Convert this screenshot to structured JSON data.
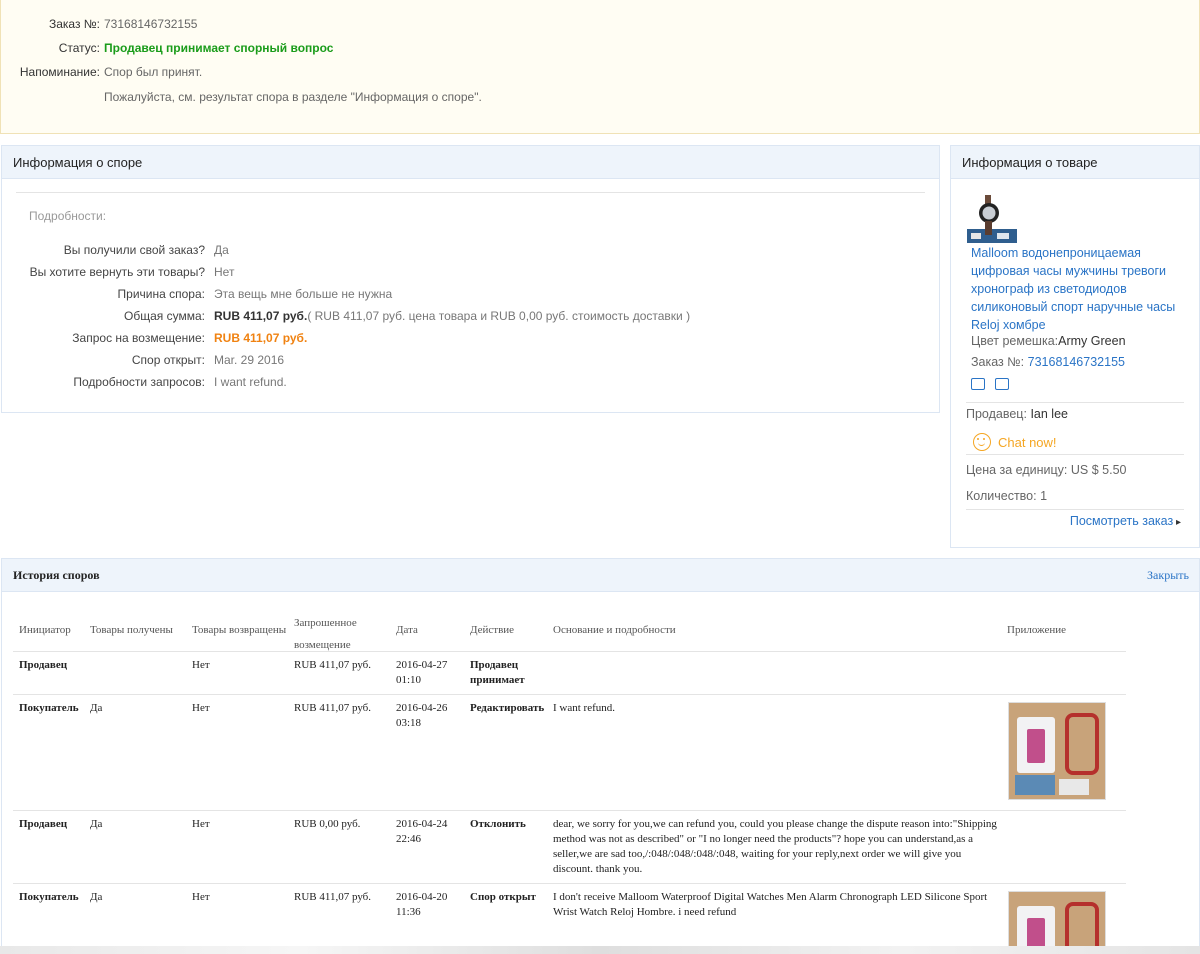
{
  "order": {
    "number_label": "Заказ №:",
    "number": "73168146732155",
    "status_label": "Статус:",
    "status": "Продавец принимает спорный вопрос",
    "reminder_label": "Напоминание:",
    "reminder_line1": "Спор был принят.",
    "reminder_line2": "Пожалуйста, см. результат спора в разделе \"Информация о споре\"."
  },
  "dispute": {
    "title": "Информация о споре",
    "details_title": "Подробности:",
    "rows": [
      {
        "label": "Вы получили свой заказ?",
        "value": "Да"
      },
      {
        "label": "Вы хотите вернуть эти товары?",
        "value": "Нет"
      },
      {
        "label": "Причина спора:",
        "value": "Эта вещь мне больше не нужна"
      },
      {
        "label": "Общая сумма:",
        "value_bold": "RUB 411,07 руб.",
        "value": "( RUB 411,07 руб. цена товара и RUB 0,00 руб. стоимость доставки )"
      },
      {
        "label": "Запрос на возмещение:",
        "value": "RUB 411,07 руб."
      },
      {
        "label": "Спор открыт:",
        "value": "Mar. 29 2016"
      },
      {
        "label": "Подробности запросов:",
        "value": "I want refund."
      }
    ]
  },
  "product": {
    "title": "Информация о товаре",
    "name": "Malloom водонепроницаемая цифровая часы мужчины тревоги хронограф из светодиодов силиконовый спорт наручные часы Reloj хомбре",
    "strap_label": "Цвет ремешка:",
    "strap_value": "Army Green",
    "order_label": "Заказ №:",
    "order_number": "73168146732155",
    "seller_label": "Продавец:",
    "seller_name": "Ian lee",
    "chat_label": "Chat now!",
    "price_label": "Цена за единицу:",
    "price_value": "US $ 5.50",
    "qty_label": "Количество:",
    "qty_value": "1",
    "view_order": "Посмотреть заказ"
  },
  "history": {
    "title": "История споров",
    "close_label": "Закрыть",
    "columns": [
      "Инициатор",
      "Товары получены",
      "Товары возвращены",
      "Запрошенное возмещение",
      "Дата",
      "Действие",
      "Основание и подробности",
      "Приложение"
    ],
    "rows": [
      {
        "initiator": "Продавец",
        "received": "",
        "returned": "Нет",
        "refund": "RUB 411,07 руб.",
        "date": "2016-04-27",
        "time": "01:10",
        "action": "Продавец принимает",
        "reason": "",
        "attachment": false
      },
      {
        "initiator": "Покупатель",
        "received": "Да",
        "returned": "Нет",
        "refund": "RUB 411,07 руб.",
        "date": "2016-04-26",
        "time": "03:18",
        "action": "Редактировать",
        "reason": "I want refund.",
        "attachment": true
      },
      {
        "initiator": "Продавец",
        "received": "Да",
        "returned": "Нет",
        "refund": "RUB 0,00 руб.",
        "date": "2016-04-24",
        "time": "22:46",
        "action": "Отклонить",
        "reason": "dear, we sorry for you,we can refund you, could you please change the dispute reason into:\"Shipping method was not as described\" or \"I no longer need the products\"? hope you can understand,as a seller,we are sad too,/:048/:048/:048/:048, waiting for your reply,next order we will give you discount. thank you.",
        "attachment": false
      },
      {
        "initiator": "Покупатель",
        "received": "Да",
        "returned": "Нет",
        "refund": "RUB 411,07 руб.",
        "date": "2016-04-20",
        "time": "11:36",
        "action": "Спор открыт",
        "reason": "I don't receive Malloom Waterproof Digital Watches Men Alarm Chronograph LED Silicone Sport Wrist Watch Reloj Hombre. i need refund",
        "attachment": true
      }
    ]
  },
  "colors": {
    "link": "#2a74c6",
    "status_green": "#1a9c1a",
    "refund_orange": "#f08211",
    "chat_orange": "#f5a623"
  }
}
